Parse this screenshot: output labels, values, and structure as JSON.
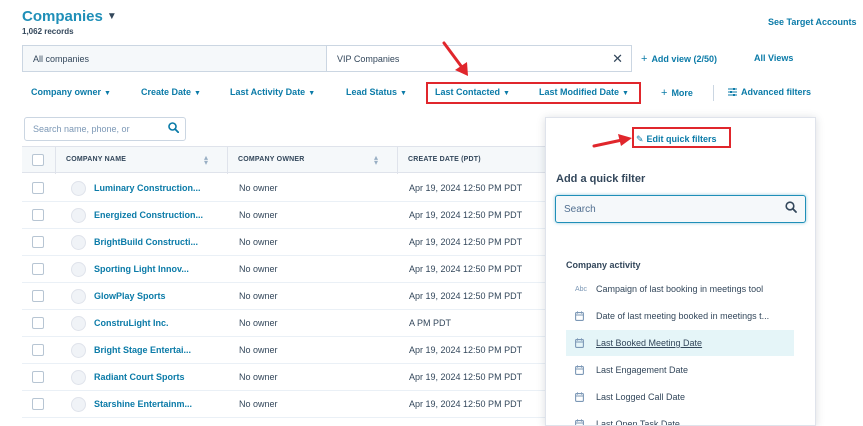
{
  "header": {
    "title": "Companies",
    "record_count": "1,062 records",
    "see_target": "See Target Accounts"
  },
  "views": {
    "tabs": [
      {
        "label": "All companies"
      },
      {
        "label": "VIP Companies"
      }
    ],
    "add_view": "Add view (2/50)",
    "all_views": "All Views"
  },
  "filters": {
    "items": [
      {
        "label": "Company owner"
      },
      {
        "label": "Create Date"
      },
      {
        "label": "Last Activity Date"
      },
      {
        "label": "Lead Status"
      },
      {
        "label": "Last Contacted"
      },
      {
        "label": "Last Modified Date"
      }
    ],
    "more": "More",
    "advanced": "Advanced filters"
  },
  "table": {
    "search_placeholder": "Search name, phone, or",
    "columns": [
      "COMPANY NAME",
      "COMPANY OWNER",
      "CREATE DATE (PDT)"
    ],
    "rows": [
      {
        "name": "Luminary Construction...",
        "owner": "No owner",
        "date": "Apr 19, 2024 12:50 PM PDT"
      },
      {
        "name": "Energized Construction...",
        "owner": "No owner",
        "date": "Apr 19, 2024 12:50 PM PDT"
      },
      {
        "name": "BrightBuild Constructi...",
        "owner": "No owner",
        "date": "Apr 19, 2024 12:50 PM PDT"
      },
      {
        "name": "Sporting Light Innov...",
        "owner": "No owner",
        "date": "Apr 19, 2024 12:50 PM PDT"
      },
      {
        "name": "GlowPlay Sports",
        "owner": "No owner",
        "date": "Apr 19, 2024 12:50 PM PDT"
      },
      {
        "name": "ConstruLight Inc.",
        "owner": "No owner",
        "date": "A          PM PDT"
      },
      {
        "name": "Bright Stage Entertai...",
        "owner": "No owner",
        "date": "Apr 19, 2024 12:50 PM PDT"
      },
      {
        "name": "Radiant Court Sports",
        "owner": "No owner",
        "date": "Apr 19, 2024 12:50 PM PDT"
      },
      {
        "name": "Starshine Entertainm...",
        "owner": "No owner",
        "date": "Apr 19, 2024 12:50 PM PDT"
      }
    ]
  },
  "quick_filters": {
    "edit_label": "Edit quick filters",
    "title": "Add a quick filter",
    "search_placeholder": "Search",
    "section": "Company activity",
    "items": [
      {
        "icon": "abc-text-icon",
        "abc": "Abc",
        "label": "Campaign of last booking in meetings tool"
      },
      {
        "icon": "calendar-icon",
        "label": "Date of last meeting booked in meetings t..."
      },
      {
        "icon": "calendar-icon",
        "label": "Last Booked Meeting Date"
      },
      {
        "icon": "calendar-icon",
        "label": "Last Engagement Date"
      },
      {
        "icon": "calendar-icon",
        "label": "Last Logged Call Date"
      },
      {
        "icon": "calendar-icon",
        "label": "Last Open Task Date"
      }
    ]
  },
  "colors": {
    "link": "#0b7ba8",
    "title": "#1f8fb8",
    "highlight": "#e0262c",
    "selected_row": "#e5f5f8"
  }
}
